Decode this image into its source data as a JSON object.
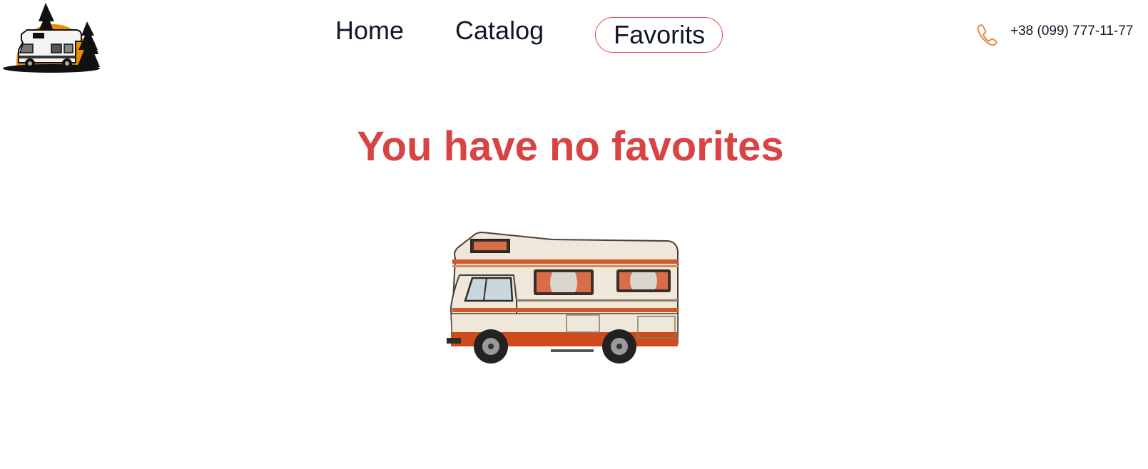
{
  "header": {
    "nav": {
      "home": "Home",
      "catalog": "Catalog",
      "favorites": "Favorits"
    },
    "phone": "+38 (099) 777-11-77"
  },
  "main": {
    "empty_message": "You have no favorites"
  },
  "colors": {
    "accent": "#e44848",
    "title": "#d84343",
    "logo_sun": "#f08a00",
    "phone_icon": "#e88a3c",
    "text": "#101828"
  },
  "icons": {
    "logo": "camper-logo-icon",
    "phone": "phone-icon",
    "illustration": "camper-van-illustration"
  }
}
